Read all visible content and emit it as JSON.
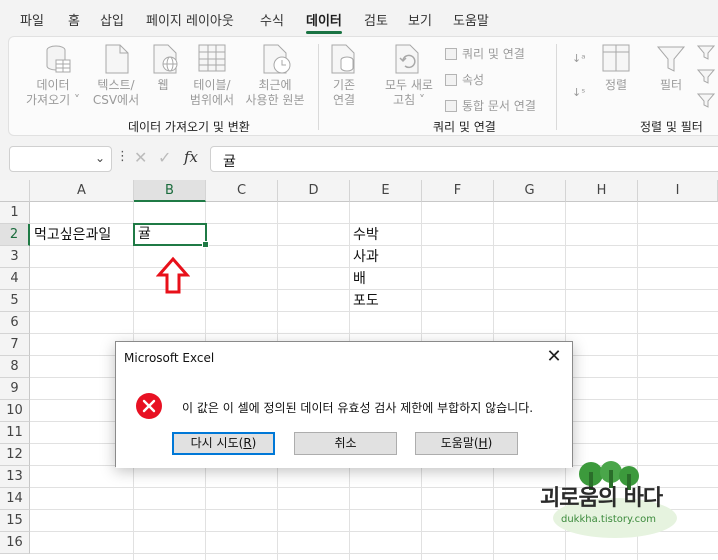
{
  "menu": {
    "tabs": [
      "파일",
      "홈",
      "삽입",
      "페이지 레이아웃",
      "수식",
      "데이터",
      "검토",
      "보기",
      "도움말"
    ],
    "active_tab": "데이터"
  },
  "ribbon": {
    "get_data": [
      "데이터",
      "가져오기"
    ],
    "from_text_csv": [
      "텍스트/",
      "CSV에서"
    ],
    "web": "웹",
    "from_table": [
      "테이블/",
      "범위에서"
    ],
    "recent_sources": [
      "최근에",
      "사용한 원본"
    ],
    "existing_connections": [
      "기존",
      "연결"
    ],
    "refresh_all": [
      "모두 새로",
      "고침"
    ],
    "queries_connections": "쿼리 및 연결",
    "properties": "속성",
    "edit_links": "통합 문서 연결",
    "sort": "정렬",
    "filter": "필터",
    "group_get_data": "데이터 가져오기 및 변환",
    "group_queries": "쿼리 및 연결",
    "group_sort_filter": "정렬 및 필터"
  },
  "formula_bar": {
    "name_box": "",
    "fx_label": "fx",
    "content": "귤"
  },
  "grid": {
    "columns": [
      "A",
      "B",
      "C",
      "D",
      "E",
      "F",
      "G",
      "H",
      "I"
    ],
    "selected_column": "B",
    "rows": [
      "1",
      "2",
      "3",
      "4",
      "5",
      "6",
      "7",
      "8",
      "9",
      "10",
      "11",
      "12",
      "13",
      "14",
      "15",
      "16"
    ],
    "selected_row": "2",
    "cells": {
      "A2": "먹고싶은과일",
      "B2": "귤",
      "E2": "수박",
      "E3": "사과",
      "E4": "배",
      "E5": "포도"
    }
  },
  "dialog": {
    "title": "Microsoft Excel",
    "message": "이 값은 이 셀에 정의된 데이터 유효성 검사 제한에 부합하지 않습니다.",
    "buttons": {
      "retry": "다시 시도",
      "retry_key": "R",
      "cancel": "취소",
      "help": "도움말",
      "help_key": "H"
    }
  },
  "watermark": {
    "text": "괴로움의 바다",
    "url": "dukkha.tistory.com"
  },
  "colors": {
    "excel_green": "#1f7a45",
    "arrow_red": "#e8101a",
    "error_red": "#e81123"
  }
}
